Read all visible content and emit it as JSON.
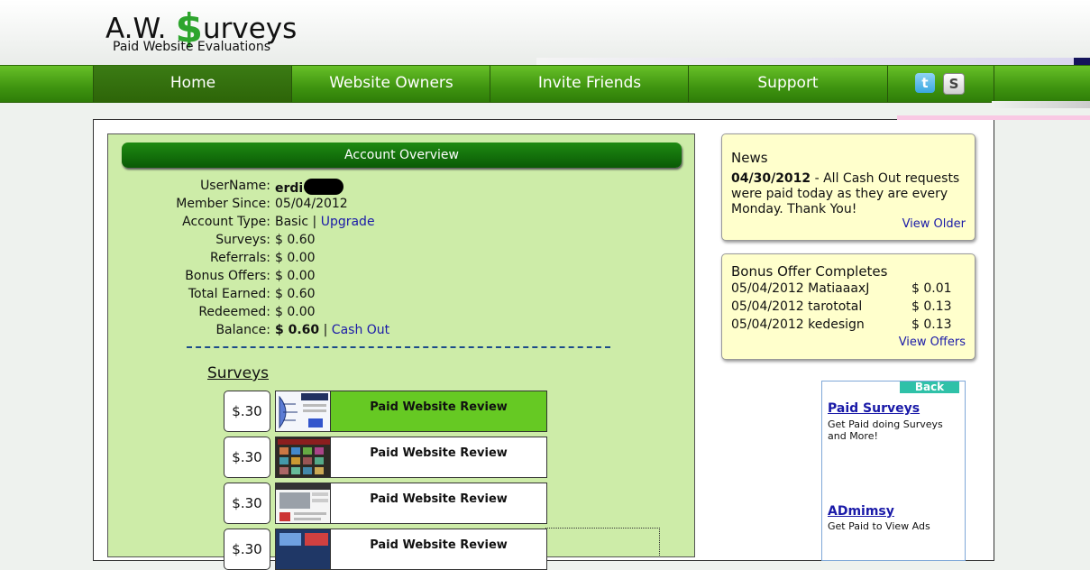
{
  "logo": {
    "title_pre": "A.W. ",
    "title_dollar": "$",
    "title_post": "urveys",
    "subtitle": "Paid Website Evaluations"
  },
  "nav": {
    "items": [
      "Home",
      "Website Owners",
      "Invite Friends",
      "Support"
    ],
    "active": "Home"
  },
  "social": {
    "twitter_glyph": "t",
    "skype_glyph": "S"
  },
  "account": {
    "header": "Account Overview",
    "username_label": "UserName:",
    "username_value": "erdi",
    "member_since_label": "Member Since:",
    "member_since_value": "05/04/2012",
    "type_label": "Account Type:",
    "type_value": "Basic",
    "separator": " | ",
    "upgrade_link": "Upgrade",
    "surveys_label": "Surveys:",
    "surveys_value": "$ 0.60",
    "referrals_label": "Referrals:",
    "referrals_value": "$ 0.00",
    "bonus_label": "Bonus Offers:",
    "bonus_value": "$ 0.00",
    "total_label": "Total Earned:",
    "total_value": "$ 0.60",
    "redeemed_label": "Redeemed:",
    "redeemed_value": "$ 0.00",
    "balance_label": "Balance:",
    "balance_value": "$ 0.60",
    "cashout_link": "Cash Out"
  },
  "surveys": {
    "title": "Surveys",
    "items": [
      {
        "price": "$.30",
        "label": "Paid Website Review"
      },
      {
        "price": "$.30",
        "label": "Paid Website Review"
      },
      {
        "price": "$.30",
        "label": "Paid Website Review"
      },
      {
        "price": "$.30",
        "label": "Paid Website Review"
      }
    ]
  },
  "news": {
    "title": "News",
    "date": "04/30/2012",
    "text": " - All Cash Out requests were paid today as they are every Monday. Thank You!",
    "link": "View Older"
  },
  "bonus": {
    "title": "Bonus Offer Completes",
    "rows": [
      {
        "entry": "05/04/2012 MatiaaaxJ",
        "amount": "$ 0.01"
      },
      {
        "entry": "05/04/2012 tarototal",
        "amount": "$ 0.13"
      },
      {
        "entry": "05/04/2012 kedesign",
        "amount": "$ 0.13"
      }
    ],
    "link": "View Offers"
  },
  "ad": {
    "back": "Back",
    "items": [
      {
        "title": "Paid Surveys",
        "text": "Get Paid doing Surveys and More!"
      },
      {
        "title": "ADmimsy",
        "text": "Get Paid to View Ads"
      }
    ]
  }
}
